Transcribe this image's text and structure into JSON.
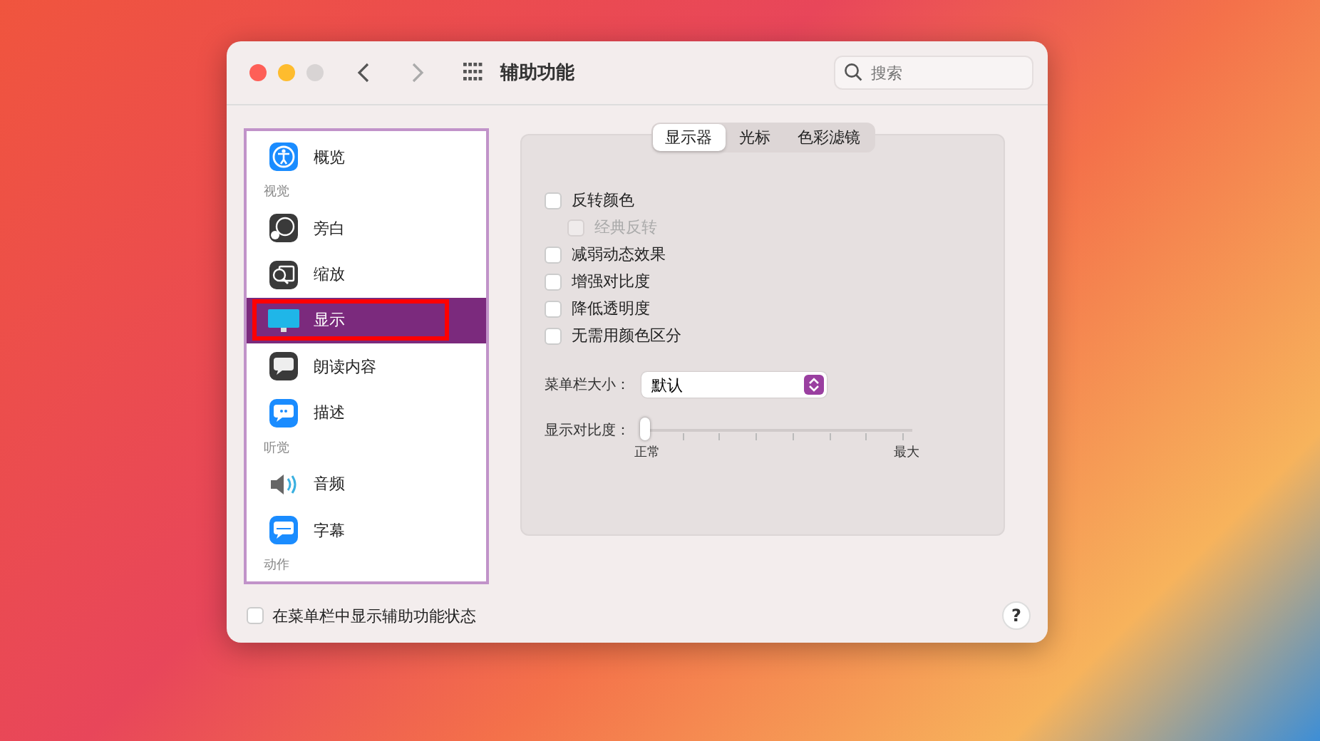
{
  "window": {
    "title": "辅助功能",
    "search": {
      "placeholder": "搜索"
    }
  },
  "sidebar": {
    "items": [
      {
        "kind": "item",
        "label": "概览",
        "selected": false
      },
      {
        "kind": "header",
        "label": "视觉"
      },
      {
        "kind": "item",
        "label": "旁白",
        "selected": false
      },
      {
        "kind": "item",
        "label": "缩放",
        "selected": false
      },
      {
        "kind": "item",
        "label": "显示",
        "selected": true
      },
      {
        "kind": "item",
        "label": "朗读内容",
        "selected": false
      },
      {
        "kind": "item",
        "label": "描述",
        "selected": false
      },
      {
        "kind": "header",
        "label": "听觉"
      },
      {
        "kind": "item",
        "label": "音频",
        "selected": false
      },
      {
        "kind": "item",
        "label": "字幕",
        "selected": false
      },
      {
        "kind": "header",
        "label": "动作"
      }
    ]
  },
  "tabs": [
    {
      "label": "显示器",
      "selected": true
    },
    {
      "label": "光标",
      "selected": false
    },
    {
      "label": "色彩滤镜",
      "selected": false
    }
  ],
  "options": [
    {
      "label": "反转颜色",
      "checked": false,
      "disabled": false,
      "children": [
        {
          "label": "经典反转",
          "checked": false,
          "disabled": true
        }
      ]
    },
    {
      "label": "减弱动态效果",
      "checked": false,
      "disabled": false
    },
    {
      "label": "增强对比度",
      "checked": false,
      "disabled": false
    },
    {
      "label": "降低透明度",
      "checked": false,
      "disabled": false
    },
    {
      "label": "无需用颜色区分",
      "checked": false,
      "disabled": false
    }
  ],
  "menu_bar_size": {
    "label": "菜单栏大小：",
    "value": "默认"
  },
  "contrast": {
    "label": "显示对比度：",
    "level": 0,
    "min_label": "正常",
    "max_label": "最大"
  },
  "footer": {
    "label": "在菜单栏中显示辅助功能状态",
    "checked": false,
    "help": "?"
  }
}
